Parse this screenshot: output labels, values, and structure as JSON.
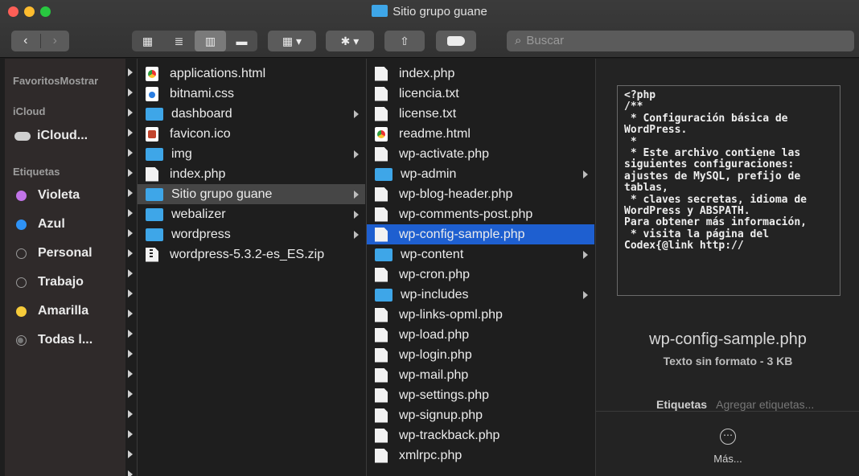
{
  "window": {
    "title": "Sitio grupo guane"
  },
  "toolbar": {
    "back": "‹",
    "forward": "›",
    "view_icons": "▦",
    "view_list": "≣",
    "view_columns": "▥",
    "view_gallery": "▬",
    "group": "▦ ▾",
    "action": "✱ ▾",
    "share": "⇧",
    "search_placeholder": "Buscar",
    "search_icon": "⌕"
  },
  "sidebar": {
    "favoritos": "FavoritosMostrar",
    "icloud_head": "iCloud",
    "icloud_item": "iCloud...",
    "etiquetas_head": "Etiquetas",
    "tags": [
      {
        "label": "Violeta",
        "color": "#c174e8"
      },
      {
        "label": "Azul",
        "color": "#2e92f5"
      },
      {
        "label": "Personal",
        "color": "hollow"
      },
      {
        "label": "Trabajo",
        "color": "hollow"
      },
      {
        "label": "Amarilla",
        "color": "#f6cb3a"
      },
      {
        "label": "Todas l...",
        "color": "hollow-gray"
      }
    ]
  },
  "column1": [
    {
      "name": "applications.html",
      "icon": "html-icon",
      "folder": false
    },
    {
      "name": "bitnami.css",
      "icon": "css-icon",
      "folder": false
    },
    {
      "name": "dashboard",
      "icon": "folder-icon",
      "folder": true
    },
    {
      "name": "favicon.ico",
      "icon": "favicon-icon",
      "folder": false
    },
    {
      "name": "img",
      "icon": "folder-icon",
      "folder": true
    },
    {
      "name": "index.php",
      "icon": "document-icon",
      "folder": false
    },
    {
      "name": "Sitio grupo guane",
      "icon": "folder-icon",
      "folder": true,
      "selected": true
    },
    {
      "name": "webalizer",
      "icon": "folder-icon",
      "folder": true
    },
    {
      "name": "wordpress",
      "icon": "folder-icon",
      "folder": true
    },
    {
      "name": "wordpress-5.3.2-es_ES.zip",
      "icon": "zip-icon",
      "folder": false
    }
  ],
  "column2": [
    {
      "name": "index.php",
      "icon": "document-icon",
      "folder": false
    },
    {
      "name": "licencia.txt",
      "icon": "document-icon",
      "folder": false
    },
    {
      "name": "license.txt",
      "icon": "document-icon",
      "folder": false
    },
    {
      "name": "readme.html",
      "icon": "html-icon",
      "folder": false
    },
    {
      "name": "wp-activate.php",
      "icon": "document-icon",
      "folder": false
    },
    {
      "name": "wp-admin",
      "icon": "folder-icon",
      "folder": true
    },
    {
      "name": "wp-blog-header.php",
      "icon": "document-icon",
      "folder": false
    },
    {
      "name": "wp-comments-post.php",
      "icon": "document-icon",
      "folder": false
    },
    {
      "name": "wp-config-sample.php",
      "icon": "document-icon",
      "folder": false,
      "selected": true
    },
    {
      "name": "wp-content",
      "icon": "folder-icon",
      "folder": true
    },
    {
      "name": "wp-cron.php",
      "icon": "document-icon",
      "folder": false
    },
    {
      "name": "wp-includes",
      "icon": "folder-icon",
      "folder": true
    },
    {
      "name": "wp-links-opml.php",
      "icon": "document-icon",
      "folder": false
    },
    {
      "name": "wp-load.php",
      "icon": "document-icon",
      "folder": false
    },
    {
      "name": "wp-login.php",
      "icon": "document-icon",
      "folder": false
    },
    {
      "name": "wp-mail.php",
      "icon": "document-icon",
      "folder": false
    },
    {
      "name": "wp-settings.php",
      "icon": "document-icon",
      "folder": false
    },
    {
      "name": "wp-signup.php",
      "icon": "document-icon",
      "folder": false
    },
    {
      "name": "wp-trackback.php",
      "icon": "document-icon",
      "folder": false
    },
    {
      "name": "xmlrpc.php",
      "icon": "document-icon",
      "folder": false
    }
  ],
  "preview": {
    "code": "<?php\n/**\n * Configuración básica de WordPress.\n *\n * Este archivo contiene las siguientes configuraciones: ajustes de MySQL, prefijo de tablas,\n * claves secretas, idioma de WordPress y ABSPATH.\nPara obtener más información,\n * visita la página del\nCodex{@link http://",
    "filename": "wp-config-sample.php",
    "meta": "Texto sin formato - 3 KB",
    "tags_label": "Etiquetas",
    "tags_placeholder": "Agregar etiquetas...",
    "more_label": "Más..."
  }
}
